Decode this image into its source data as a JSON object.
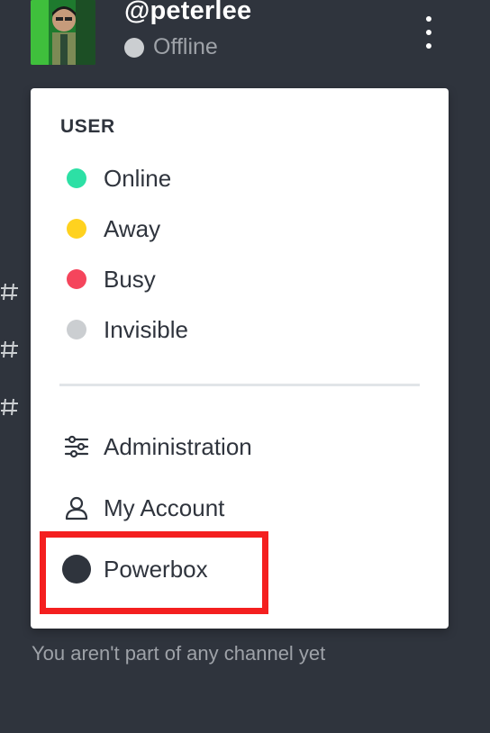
{
  "header": {
    "username": "@peterlee",
    "status": "Offline",
    "status_color": "#cbced1"
  },
  "popover": {
    "section_title": "USER",
    "statuses": [
      {
        "label": "Online",
        "color": "#2de0a5"
      },
      {
        "label": "Away",
        "color": "#ffd21f"
      },
      {
        "label": "Busy",
        "color": "#f5455c"
      },
      {
        "label": "Invisible",
        "color": "#cbced1"
      }
    ],
    "actions": [
      {
        "label": "Administration",
        "icon": "sliders-icon"
      },
      {
        "label": "My Account",
        "icon": "user-icon"
      },
      {
        "label": "Powerbox",
        "icon": "powerbox-icon"
      }
    ]
  },
  "sidebar": {
    "empty_message": "You aren't part of any channel yet"
  },
  "colors": {
    "background": "#2f343d",
    "menu_text": "#2f343d",
    "highlight": "#f41f1f"
  }
}
